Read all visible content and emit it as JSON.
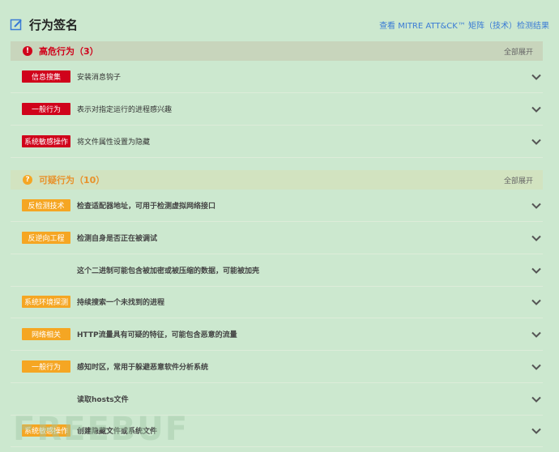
{
  "header": {
    "title": "行为签名",
    "mitre_link": "查看 MITRE ATT&CK™ 矩阵（技术）检测结果"
  },
  "colors": {
    "high": "#d0021b",
    "suspicious": "#f5a623",
    "link": "#3a7bd5"
  },
  "sections": [
    {
      "title": "高危行为（3）",
      "expand_label": "全部展开",
      "icon": "exclamation-icon",
      "rows": [
        {
          "tag": "信息搜集",
          "desc": "安装消息钩子"
        },
        {
          "tag": "一般行为",
          "desc": "表示对指定运行的进程感兴趣"
        },
        {
          "tag": "系统敏感操作",
          "desc": "将文件属性设置为隐藏"
        }
      ]
    },
    {
      "title": "可疑行为（10）",
      "expand_label": "全部展开",
      "icon": "question-icon",
      "rows": [
        {
          "tag": "反检测技术",
          "desc": "检查适配器地址，可用于检测虚拟网络接口"
        },
        {
          "tag": "反逆向工程",
          "desc": "检测自身是否正在被调试"
        },
        {
          "tag": "",
          "desc": "这个二进制可能包含被加密或被压缩的数据，可能被加壳"
        },
        {
          "tag": "系统环境探测",
          "desc": "持续搜索一个未找到的进程"
        },
        {
          "tag": "网络相关",
          "desc": "HTTP流量具有可疑的特征，可能包含恶意的流量"
        },
        {
          "tag": "一般行为",
          "desc": "感知时区，常用于躲避恶意软件分析系统"
        },
        {
          "tag": "",
          "desc": "读取hosts文件"
        },
        {
          "tag": "系统敏感操作",
          "desc": "创建隐藏文件或系统文件"
        }
      ]
    }
  ],
  "watermark": "FREEBUF"
}
